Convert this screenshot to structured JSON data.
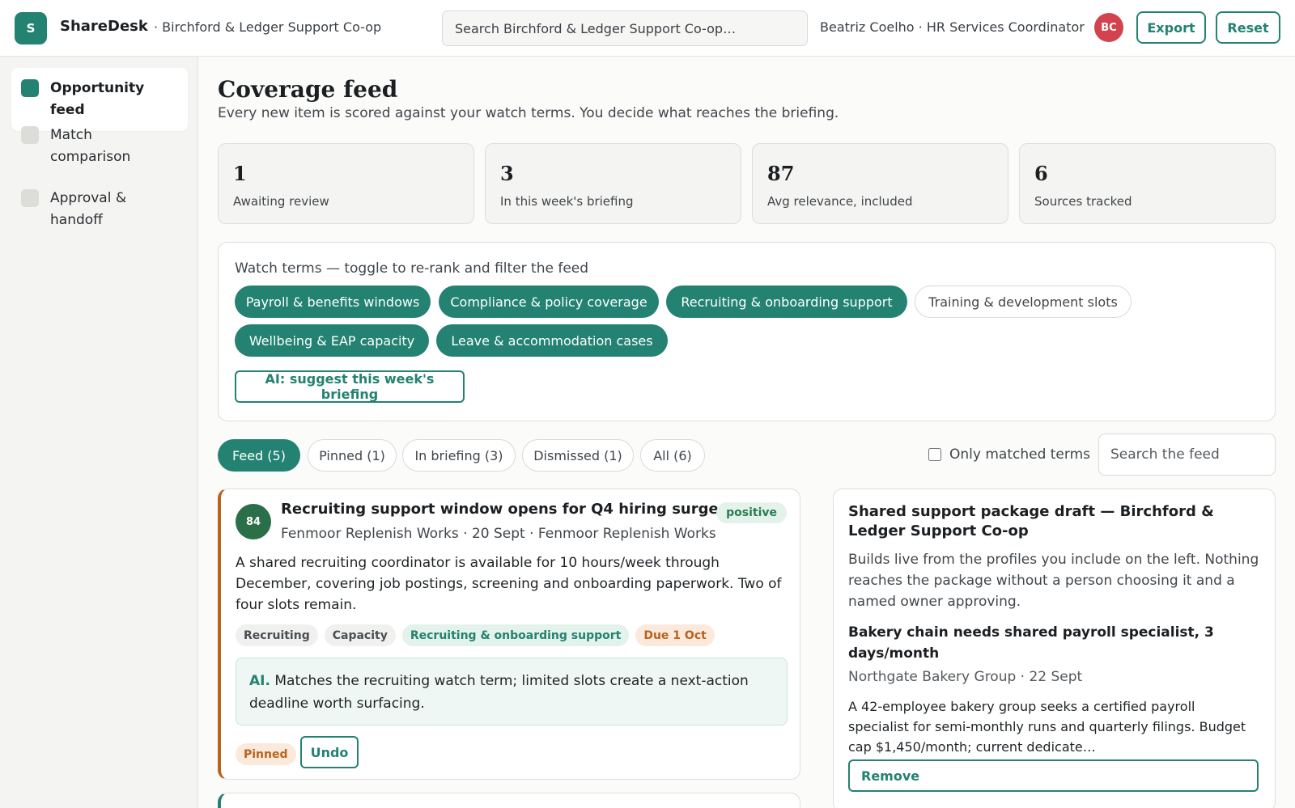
{
  "header": {
    "logo_letter": "S",
    "brand": "ShareDesk",
    "org": "· Birchford & Ledger Support Co-op",
    "search_placeholder": "Search Birchford & Ledger Support Co-op…",
    "user": "Beatriz Coelho · HR Services Coordinator",
    "avatar_initials": "BC",
    "export_label": "Export",
    "reset_label": "Reset"
  },
  "sidebar": {
    "items": [
      {
        "label": "Opportunity feed",
        "active": true
      },
      {
        "label": "Match comparison",
        "active": false
      },
      {
        "label": "Approval & handoff",
        "active": false
      }
    ]
  },
  "main": {
    "title": "Coverage feed",
    "subtitle": "Every new item is scored against your watch terms. You decide what reaches the briefing.",
    "stats": [
      {
        "value": "1",
        "label": "Awaiting review"
      },
      {
        "value": "3",
        "label": "In this week's briefing"
      },
      {
        "value": "87",
        "label": "Avg relevance, included"
      },
      {
        "value": "6",
        "label": "Sources tracked"
      }
    ],
    "watch": {
      "title": "Watch terms — toggle to re-rank and filter the feed",
      "terms": [
        {
          "label": "Payroll & benefits windows",
          "on": true
        },
        {
          "label": "Compliance & policy coverage",
          "on": true
        },
        {
          "label": "Recruiting & onboarding support",
          "on": true
        },
        {
          "label": "Training & development slots",
          "on": false
        },
        {
          "label": "Wellbeing & EAP capacity",
          "on": true
        },
        {
          "label": "Leave & accommodation cases",
          "on": true
        }
      ],
      "ai_button": "AI: suggest this week's briefing"
    },
    "tabs": [
      {
        "label": "Feed (5)",
        "active": true
      },
      {
        "label": "Pinned (1)",
        "active": false
      },
      {
        "label": "In briefing (3)",
        "active": false
      },
      {
        "label": "Dismissed (1)",
        "active": false
      },
      {
        "label": "All (6)",
        "active": false
      }
    ],
    "only_matched_label": "Only matched terms",
    "feed_search_placeholder": "Search the feed"
  },
  "feed_card": {
    "score": "84",
    "title": "Recruiting support window opens for Q4 hiring surge",
    "sentiment": "positive",
    "meta": "Fenmoor Replenish Works · 20 Sept · Fenmoor Replenish Works",
    "body": "A shared recruiting coordinator is available for 10 hours/week through December, covering job postings, screening and onboarding paperwork. Two of four slots remain.",
    "tags": [
      {
        "label": "Recruiting",
        "style": "grey"
      },
      {
        "label": "Capacity",
        "style": "grey"
      },
      {
        "label": "Recruiting & onboarding support",
        "style": "green"
      },
      {
        "label": "Due 1 Oct",
        "style": "orange"
      }
    ],
    "ai_prefix": "AI.",
    "ai_text": "Matches the recruiting watch term; limited slots create a next-action deadline worth surfacing.",
    "status": "Pinned",
    "undo_label": "Undo"
  },
  "package": {
    "title": "Shared support package draft — Birchford & Ledger Support Co-op",
    "description": "Builds live from the profiles you include on the left. Nothing reaches the package without a person choosing it and a named owner approving.",
    "item": {
      "title": "Bakery chain needs shared payroll specialist, 3 days/month",
      "meta": "Northgate Bakery Group · 22 Sept",
      "description": "A 42-employee bakery group seeks a certified payroll specialist for semi-monthly runs and quarterly filings. Budget cap $1,450/month; current dedicate…",
      "remove_label": "Remove"
    }
  },
  "colors": {
    "accent": "#238271",
    "avatar": "#d2424f",
    "pinned_border": "#b8631f",
    "score_badge": "#2b6f48"
  }
}
